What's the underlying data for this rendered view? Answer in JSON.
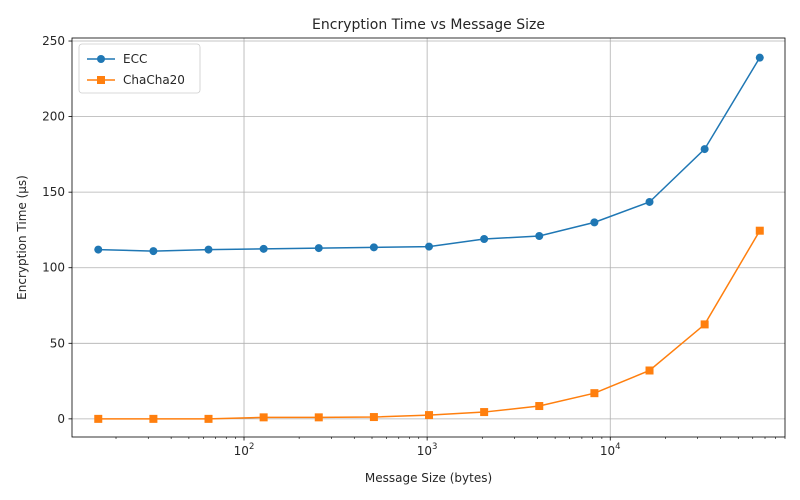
{
  "chart_data": {
    "type": "line",
    "title": "Encryption Time vs Message Size",
    "xlabel": "Message Size (bytes)",
    "ylabel": "Encryption Time (µs)",
    "xscale": "log",
    "xlim": [
      11.5,
      90000
    ],
    "ylim": [
      -12,
      252
    ],
    "grid": true,
    "legend_position": "top-left",
    "x": [
      16,
      32,
      64,
      128,
      256,
      512,
      1024,
      2048,
      4096,
      8192,
      16384,
      32768,
      65536
    ],
    "x_ticks": [
      {
        "base": "10",
        "exp": "2",
        "value": 100
      },
      {
        "base": "10",
        "exp": "3",
        "value": 1000
      },
      {
        "base": "10",
        "exp": "4",
        "value": 10000
      }
    ],
    "y_ticks": [
      0,
      50,
      100,
      150,
      200,
      250
    ],
    "series": [
      {
        "name": "ECC",
        "color": "#1f77b4",
        "marker": "circle",
        "values": [
          112,
          111,
          112,
          112.5,
          113,
          113.5,
          114,
          119,
          121,
          130,
          143.5,
          178.5,
          239
        ]
      },
      {
        "name": "ChaCha20",
        "color": "#ff7f0e",
        "marker": "square",
        "values": [
          0,
          0,
          0,
          1,
          1,
          1.2,
          2.5,
          4.5,
          8.5,
          17,
          32,
          62.5,
          124.5
        ]
      }
    ]
  }
}
